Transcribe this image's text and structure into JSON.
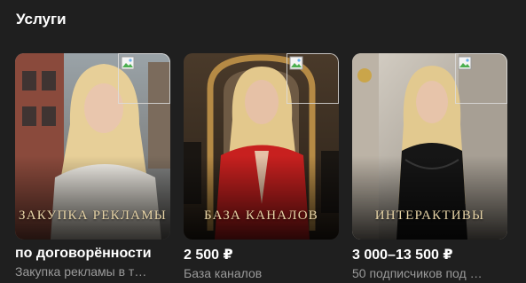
{
  "section": {
    "title": "Услуги"
  },
  "services": [
    {
      "overlay": "ЗАКУПКА РЕКЛАМЫ",
      "price": "по договорённости",
      "subtitle": "Закупка рекламы в т…"
    },
    {
      "overlay": "БАЗА КАНАЛОВ",
      "price": "2 500 ₽",
      "subtitle": "База каналов"
    },
    {
      "overlay": "ИНТЕРАКТИВЫ",
      "price": "3 000–13 500 ₽",
      "subtitle": "50 подписчиков под …"
    }
  ],
  "colors": {
    "background": "#1f1f1f",
    "overlay_text": "#e6d3a6",
    "subtitle": "#9a9a9a"
  }
}
